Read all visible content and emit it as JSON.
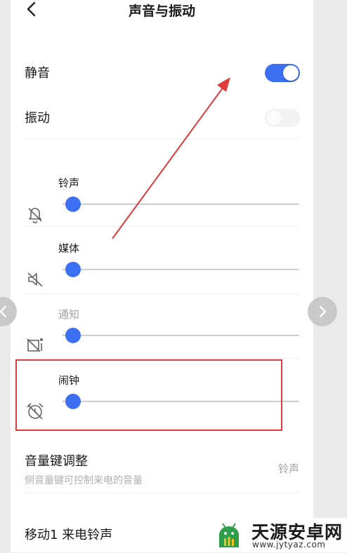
{
  "header": {
    "title": "声音与振动"
  },
  "toggles": {
    "silent": {
      "label": "静音",
      "state": "on"
    },
    "vibrate": {
      "label": "振动",
      "state": "off"
    }
  },
  "volumes": [
    {
      "label": "铃声",
      "level": 0.0,
      "icon": "bell-icon",
      "enabled": true
    },
    {
      "label": "媒体",
      "level": 0.0,
      "icon": "speaker-muted-icon",
      "enabled": true
    },
    {
      "label": "通知",
      "level": 0.0,
      "icon": "notification-icon",
      "enabled": false
    },
    {
      "label": "闹钟",
      "level": 0.0,
      "icon": "alarm-clock-icon",
      "enabled": true
    }
  ],
  "volume_key": {
    "title": "音量键调整",
    "desc": "侧音量键可控制来电的音量",
    "value": "铃声"
  },
  "ringtone": {
    "title": "移动1 来电铃声"
  },
  "watermark": {
    "name": "天源安卓网",
    "url": "www.jytyaz.com"
  },
  "colors": {
    "accent": "#3d6ff2",
    "annotation": "#e03b3b"
  }
}
